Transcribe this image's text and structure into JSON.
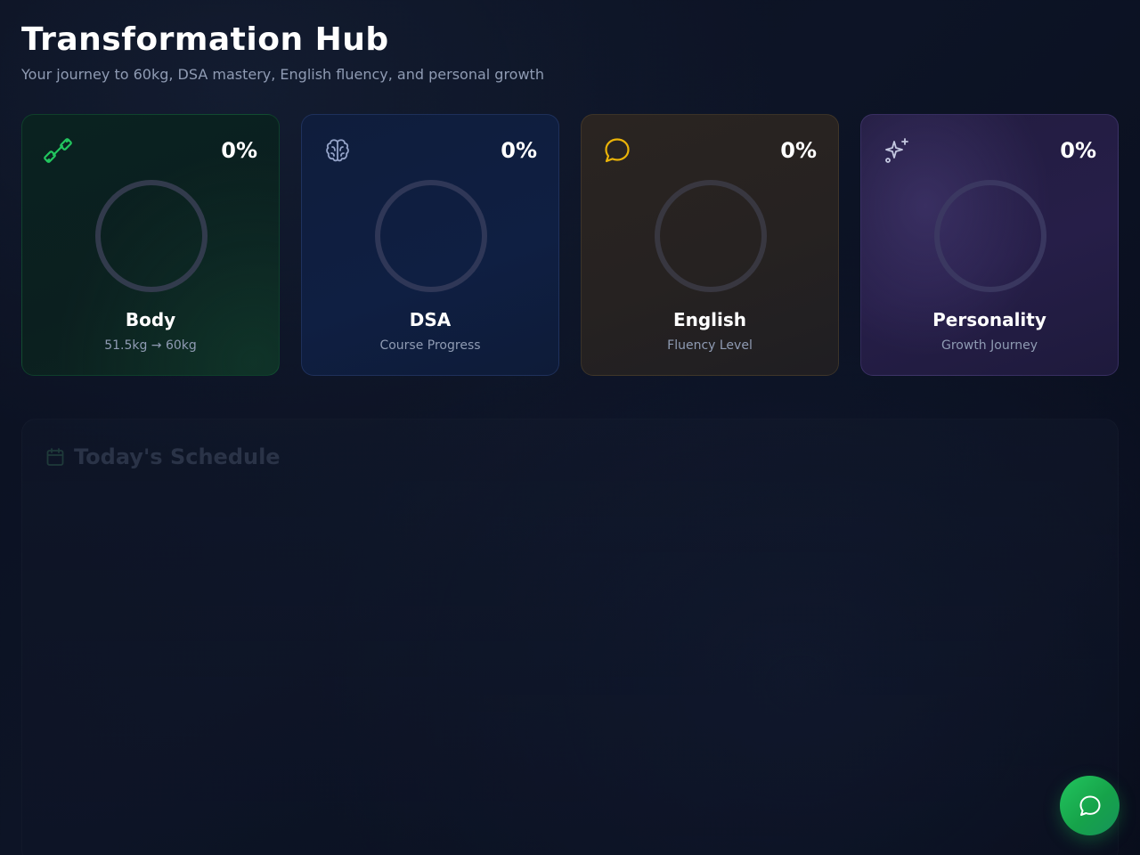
{
  "header": {
    "title": "Transformation Hub",
    "subtitle": "Your journey to 60kg, DSA mastery, English fluency, and personal growth"
  },
  "cards": [
    {
      "name": "Body",
      "subtitle": "51.5kg → 60kg",
      "percent": "0%",
      "progress": 0,
      "icon": "dumbbell-icon",
      "accent": "#22c55e"
    },
    {
      "name": "DSA",
      "subtitle": "Course Progress",
      "percent": "0%",
      "progress": 0,
      "icon": "brain-icon",
      "accent": "#94a3c8"
    },
    {
      "name": "English",
      "subtitle": "Fluency Level",
      "percent": "0%",
      "progress": 0,
      "icon": "chat-bubble-icon",
      "accent": "#eab308"
    },
    {
      "name": "Personality",
      "subtitle": "Growth Journey",
      "percent": "0%",
      "progress": 0,
      "icon": "sparkles-icon",
      "accent": "#c4c8e0"
    }
  ],
  "schedule": {
    "title": "Today's Schedule",
    "icon": "calendar-icon"
  },
  "chat_button": {
    "icon": "chat-bubble-icon",
    "color": "#22c55e"
  }
}
